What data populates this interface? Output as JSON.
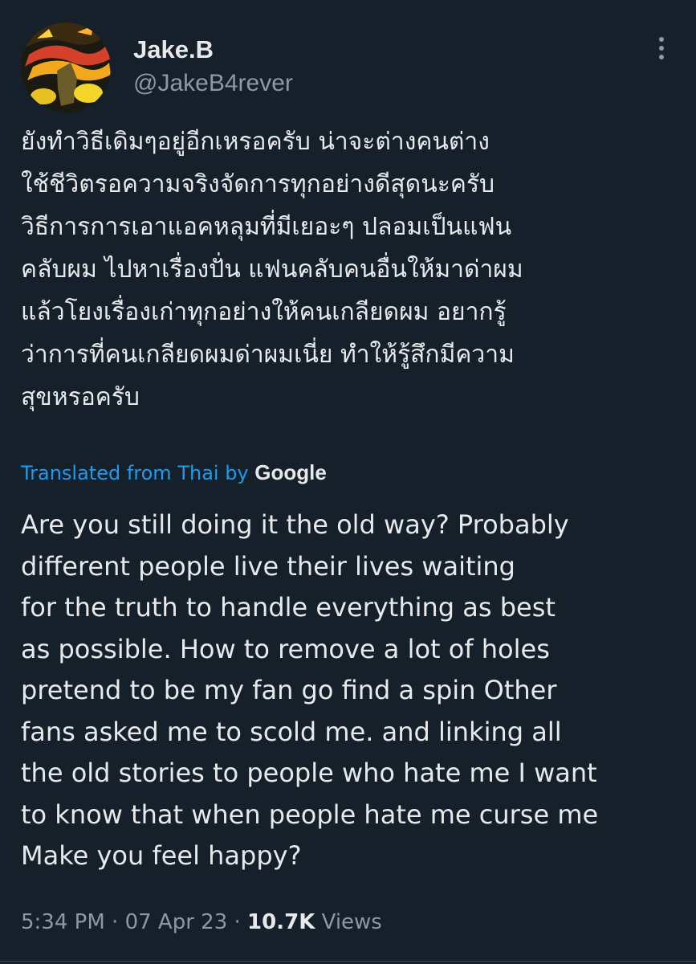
{
  "author": {
    "display_name": "Jake.B",
    "handle": "@JakeB4rever"
  },
  "icons": {
    "avatar": "user-avatar",
    "more": "more-dots-icon"
  },
  "tweet": {
    "original_text": "ยังทำวิธีเดิมๆอยู่อีกเหรอครับ น่าจะต่างคนต่าง\nใช้ชีวิตรอความจริงจัดการทุกอย่างดีสุดนะครับ\nวิธีการการเอาแอคหลุมที่มีเยอะๆ ปลอมเป็นแฟน\nคลับผม ไปหาเรื่องปั่น แฟนคลับคนอื่นให้มาด่าผม\nแล้วโยงเรื่องเก่าทุกอย่างให้คนเกลียดผม อยากรู้\nว่าการที่คนเกลียดผมด่าผมเนี่ย ทำให้รู้สึกมีความ\nสุขหรอครับ",
    "translation_label": "Translated from Thai by",
    "translation_provider": "Google",
    "translated_text": "Are you still doing it the old way? Probably\ndifferent people live their lives waiting\nfor the truth to handle everything as best\nas possible. How to remove a lot of holes\npretend to be my fan go find a spin Other\nfans asked me to scold me. and linking all\nthe old stories to people who hate me I want\nto know that when people hate me curse me\nMake you feel happy?"
  },
  "meta": {
    "time": "5:34 PM",
    "separator": "·",
    "date": "07 Apr 23",
    "views_count": "10.7K",
    "views_label": "Views"
  },
  "colors": {
    "background": "#15202b",
    "text_primary": "#e7e9ea",
    "text_secondary": "#8b98a5",
    "link": "#1d9bf0"
  }
}
